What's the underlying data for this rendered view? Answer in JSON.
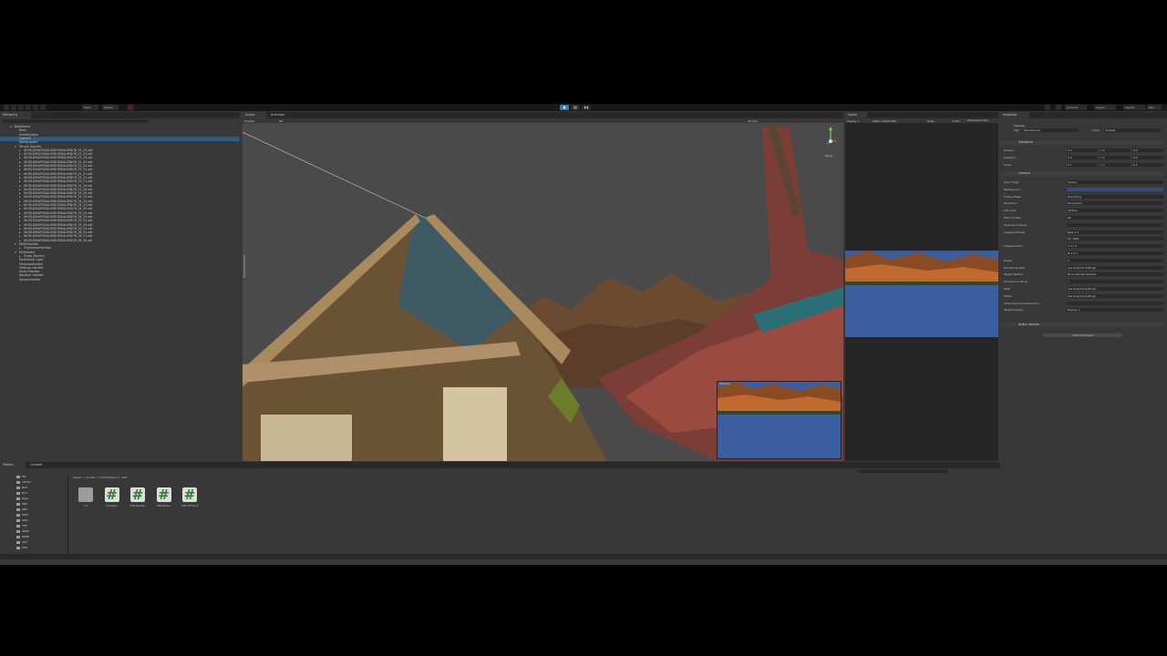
{
  "toolbar": {
    "account_label": "Account",
    "layers_label": "Layers",
    "layout_label": "Layout",
    "branch_label": "Dev",
    "git_label": "Git"
  },
  "hierarchy": {
    "tab": "Hierarchy",
    "rows": [
      {
        "label": "BootScene",
        "sel": false,
        "ind": 0,
        "arrow": "▾"
      },
      {
        "label": "Main",
        "sel": false,
        "ind": 1,
        "arrow": ""
      },
      {
        "label": "EventSystem",
        "sel": false,
        "ind": 1,
        "arrow": ""
      },
      {
        "label": "Camera",
        "sel": true,
        "ind": 1,
        "arrow": ""
      },
      {
        "label": "WorldLoader",
        "sel": false,
        "ind": 1,
        "arrow": ""
      },
      {
        "label": "Terrain Handler",
        "sel": false,
        "ind": 1,
        "arrow": "▾"
      },
      {
        "label": "WORLD\\MAPS\\KALIMDOR\\KALIMDOR_31_33.adt",
        "sel": false,
        "ind": 2,
        "arrow": "▸"
      },
      {
        "label": "WORLD\\MAPS\\KALIMDOR\\KALIMDOR_32_33.adt",
        "sel": false,
        "ind": 2,
        "arrow": "▸"
      },
      {
        "label": "WORLD\\MAPS\\KALIMDOR\\KALIMDOR_33_33.adt",
        "sel": false,
        "ind": 2,
        "arrow": "▸"
      },
      {
        "label": "WORLD\\MAPS\\KALIMDOR\\KALIMDOR_31_32.adt",
        "sel": false,
        "ind": 2,
        "arrow": "▸"
      },
      {
        "label": "WORLD\\MAPS\\KALIMDOR\\KALIMDOR_32_32.adt",
        "sel": false,
        "ind": 2,
        "arrow": "▸"
      },
      {
        "label": "WORLD\\MAPS\\KALIMDOR\\KALIMDOR_33_32.adt",
        "sel": false,
        "ind": 2,
        "arrow": "▸"
      },
      {
        "label": "WORLD\\MAPS\\KALIMDOR\\KALIMDOR_31_31.adt",
        "sel": false,
        "ind": 2,
        "arrow": "▸"
      },
      {
        "label": "WORLD\\MAPS\\KALIMDOR\\KALIMDOR_32_31.adt",
        "sel": false,
        "ind": 2,
        "arrow": "▸"
      },
      {
        "label": "WORLD\\MAPS\\KALIMDOR\\KALIMDOR_33_31.adt",
        "sel": false,
        "ind": 2,
        "arrow": "▸"
      },
      {
        "label": "WORLD\\MAPS\\KALIMDOR\\KALIMDOR_31_30.adt",
        "sel": false,
        "ind": 2,
        "arrow": "▸"
      },
      {
        "label": "WORLD\\MAPS\\KALIMDOR\\KALIMDOR_32_30.adt",
        "sel": false,
        "ind": 2,
        "arrow": "▸"
      },
      {
        "label": "WORLD\\MAPS\\KALIMDOR\\KALIMDOR_33_30.adt",
        "sel": false,
        "ind": 2,
        "arrow": "▸"
      },
      {
        "label": "WORLD\\MAPS\\KALIMDOR\\KALIMDOR_34_33.adt",
        "sel": false,
        "ind": 2,
        "arrow": "▸"
      },
      {
        "label": "WORLD\\MAPS\\KALIMDOR\\KALIMDOR_34_32.adt",
        "sel": false,
        "ind": 2,
        "arrow": "▸"
      },
      {
        "label": "WORLD\\MAPS\\KALIMDOR\\KALIMDOR_34_31.adt",
        "sel": false,
        "ind": 2,
        "arrow": "▸"
      },
      {
        "label": "WORLD\\MAPS\\KALIMDOR\\KALIMDOR_34_30.adt",
        "sel": false,
        "ind": 2,
        "arrow": "▸"
      },
      {
        "label": "WORLD\\MAPS\\KALIMDOR\\KALIMDOR_35_33.adt",
        "sel": false,
        "ind": 2,
        "arrow": "▸"
      },
      {
        "label": "WORLD\\MAPS\\KALIMDOR\\KALIMDOR_35_32.adt",
        "sel": false,
        "ind": 2,
        "arrow": "▸"
      },
      {
        "label": "WORLD\\MAPS\\KALIMDOR\\KALIMDOR_35_31.adt",
        "sel": false,
        "ind": 2,
        "arrow": "▸"
      },
      {
        "label": "WORLD\\MAPS\\KALIMDOR\\KALIMDOR_35_30.adt",
        "sel": false,
        "ind": 2,
        "arrow": "▸"
      },
      {
        "label": "WORLD\\MAPS\\KALIMDOR\\KALIMDOR_36_33.adt",
        "sel": false,
        "ind": 2,
        "arrow": "▸"
      },
      {
        "label": "WORLD\\MAPS\\KALIMDOR\\KALIMDOR_36_32.adt",
        "sel": false,
        "ind": 2,
        "arrow": "▸"
      },
      {
        "label": "WORLD\\MAPS\\KALIMDOR\\KALIMDOR_36_31.adt",
        "sel": false,
        "ind": 2,
        "arrow": "▸"
      },
      {
        "label": "WORLD\\MAPS\\KALIMDOR\\KALIMDOR_36_30.adt",
        "sel": false,
        "ind": 2,
        "arrow": "▸"
      },
      {
        "label": "WMOHandler",
        "sel": false,
        "ind": 1,
        "arrow": "▾"
      },
      {
        "label": "OrgrimmarFortress",
        "sel": false,
        "ind": 2,
        "arrow": "▸"
      },
      {
        "label": "M2Handler",
        "sel": false,
        "ind": 1,
        "arrow": "▾"
      },
      {
        "label": "Grass_Barrens",
        "sel": false,
        "ind": 2,
        "arrow": "▸"
      },
      {
        "label": "Directional Light",
        "sel": false,
        "ind": 1,
        "arrow": ""
      },
      {
        "label": "MinimapHandler",
        "sel": false,
        "ind": 1,
        "arrow": ""
      },
      {
        "label": "Settings Handler",
        "sel": false,
        "ind": 1,
        "arrow": ""
      },
      {
        "label": "Audio Handler",
        "sel": false,
        "ind": 1,
        "arrow": ""
      },
      {
        "label": "Network Handler",
        "sel": false,
        "ind": 1,
        "arrow": ""
      },
      {
        "label": "Sound Handler",
        "sel": false,
        "ind": 1,
        "arrow": ""
      }
    ]
  },
  "scene": {
    "tab_scene": "Scene",
    "tab_animator": "Animator",
    "shading": "Shaded",
    "mode_2d": "2D",
    "gizmos": "Gizmos",
    "persp_label": "Persp",
    "camera_preview_label": "Camera"
  },
  "game": {
    "tab": "Game",
    "display": "Display 1",
    "resolution": "WXGA (1366x768)",
    "scale_label": "Scale",
    "scale_value": "0.33x",
    "maximize_label": "Maximize On Play"
  },
  "inspector": {
    "tab": "Inspector",
    "object_name": "Camera",
    "tag_label": "Tag",
    "tag_value": "MainCamera",
    "layer_label": "Layer",
    "layer_value": "Default",
    "transform": {
      "title": "Transform",
      "rows": [
        {
          "label": "Position",
          "x": "X 0",
          "y": "Y 0",
          "z": "Z 0"
        },
        {
          "label": "Rotation",
          "x": "X 0",
          "y": "Y 0",
          "z": "Z 0"
        },
        {
          "label": "Scale",
          "x": "X 1",
          "y": "Y 1",
          "z": "Z 1"
        }
      ]
    },
    "camera": {
      "title": "Camera",
      "rows": [
        {
          "label": "Clear Flags",
          "value": "Skybox"
        },
        {
          "label": "Background",
          "value": ""
        },
        {
          "label": "Culling Mask",
          "value": "Everything"
        },
        {
          "label": "Projection",
          "value": "Perspective"
        },
        {
          "label": "FOV Axis",
          "value": "Vertical"
        },
        {
          "label": "Field of View",
          "value": "60"
        },
        {
          "label": "Physical Camera",
          "value": ""
        },
        {
          "label": "Clipping Planes",
          "value": "Near 0.3"
        },
        {
          "label": "",
          "value": "Far 1000"
        },
        {
          "label": "Viewport Rect",
          "value": "X 0   Y 0"
        },
        {
          "label": "",
          "value": "W 1   H 1"
        },
        {
          "label": "Depth",
          "value": "0"
        },
        {
          "label": "Rendering Path",
          "value": "Use Graphics Settings"
        },
        {
          "label": "Target Texture",
          "value": "None (Render Texture)"
        },
        {
          "label": "Occlusion Culling",
          "value": "✔"
        },
        {
          "label": "HDR",
          "value": "Use Graphics Settings"
        },
        {
          "label": "MSAA",
          "value": "Use Graphics Settings"
        },
        {
          "label": "Allow Dynamic Resolution",
          "value": ""
        },
        {
          "label": "Target Display",
          "value": "Display 1"
        }
      ]
    },
    "audio_listener": "Audio Listener",
    "add_component": "Add Component"
  },
  "project": {
    "tab_project": "Project",
    "tab_console": "Console",
    "tree": [
      "M2",
      "AUDIO",
      "BLP",
      "BLS",
      "Data",
      "DBC",
      "DB2",
      "M2D",
      "MPQ",
      "FNT",
      "WMO",
      "WMB",
      "ADT",
      "XML"
    ],
    "breadcrumb": "Assets > Scripts > ClientHelpers > XML",
    "assets": [
      {
        "name": "UI",
        "kind": "folder"
      },
      {
        "name": "UIHelper",
        "kind": "script"
      },
      {
        "name": "XMLReader",
        "kind": "script"
      },
      {
        "name": "XMLParser",
        "kind": "script"
      },
      {
        "name": "XMLUIFrame",
        "kind": "script"
      }
    ]
  },
  "colors": {
    "play_active": "#3a79bb",
    "selection": "#2c5d87",
    "script_icon": "#2e7d32",
    "water": "#3b5ea0"
  }
}
